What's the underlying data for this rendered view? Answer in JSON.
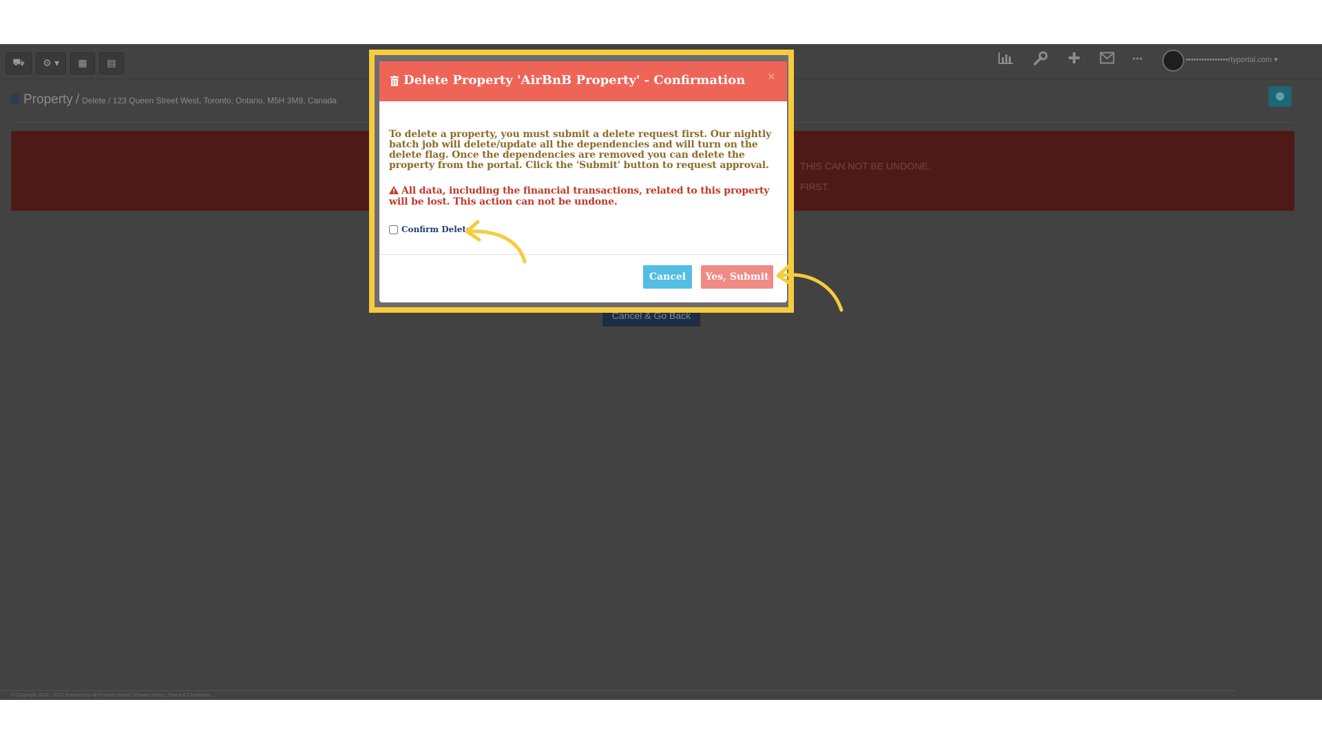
{
  "topbar": {
    "left_buttons": [
      {
        "icon": "car-icon",
        "glyph": "⛟"
      },
      {
        "icon": "gear-dropdown-icon",
        "glyph": "⚙ ▾"
      },
      {
        "icon": "calendar-icon",
        "glyph": "▦"
      },
      {
        "icon": "calculator-icon",
        "glyph": "▤"
      }
    ],
    "right_icons": [
      "bar-chart-icon",
      "wrench-icon",
      "plus-icon",
      "envelope-icon",
      "ellipsis-icon"
    ],
    "user_email": "••••••••••••••••rtyportal.com ▾"
  },
  "breadcrumb": {
    "title": "Property",
    "separator": "/",
    "sub": "Delete / 123 Queen Street West, Toronto, Ontario, M5H 3M9, Canada"
  },
  "alert": {
    "line1": "THIS CAN NOT BE UNDONE.",
    "line2": "FIRST."
  },
  "background_buttons": {
    "cancel_go_back": "Cancel & Go Back"
  },
  "footer": {
    "text": "© Copyright 2014 - 2022 Powered by All Property Portal | Privacy Policy | Terms & Conditions"
  },
  "modal": {
    "title": "Delete Property 'AirBnB Property' - Confirmation",
    "close": "×",
    "body": "To delete a property, you must submit a delete request first. Our nightly batch job will delete/update all the dependencies and will turn on the delete flag. Once the dependencies are removed you can delete the property from the portal. Click the 'Submit' button to request approval.",
    "warning": "All data, including the financial transactions, related to this property will be lost. This action can not be undone.",
    "confirm_label": "Confirm Delete",
    "confirm_checked": false,
    "cancel_label": "Cancel",
    "submit_label": "Yes, Submit"
  },
  "colors": {
    "header_red": "#ee6557",
    "body_text": "#8d6c2a",
    "warning_text": "#c0392b",
    "cancel_blue": "#53bde3",
    "submit_pink": "#f08a85",
    "highlight_yellow": "#f6cc3e"
  }
}
